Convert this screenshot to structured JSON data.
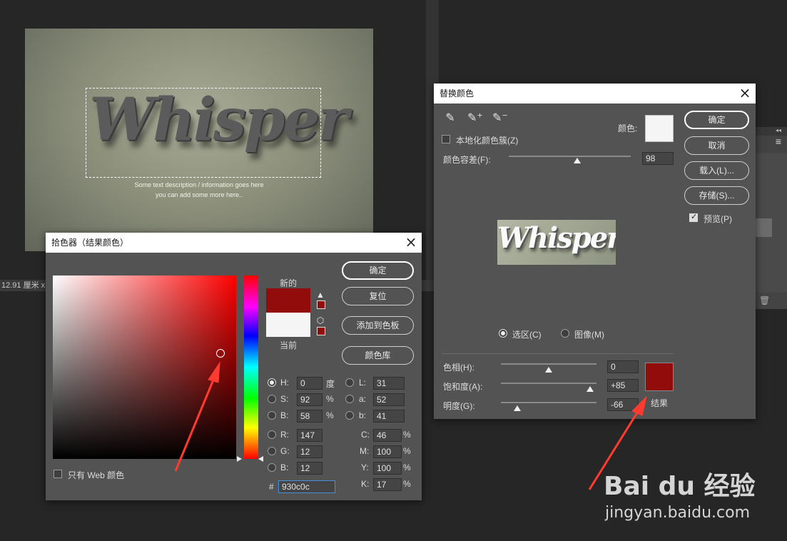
{
  "canvas": {
    "headline": "Whisper",
    "caption_line1": "Some text description / information goes here",
    "caption_line2": "you can add some more here.."
  },
  "status": {
    "dimensions": "12.91 厘米 x"
  },
  "picker": {
    "title": "拾色器（结果颜色）",
    "new_label": "新的",
    "current_label": "当前",
    "new_color": "#930c0c",
    "current_color": "#f5f5f5",
    "buttons": {
      "ok": "确定",
      "reset": "复位",
      "add_swatch": "添加到色板",
      "libraries": "颜色库"
    },
    "web_only_label": "只有 Web 颜色",
    "hsb": [
      {
        "label": "H:",
        "value": "0",
        "unit": "度"
      },
      {
        "label": "S:",
        "value": "92",
        "unit": "%"
      },
      {
        "label": "B:",
        "value": "58",
        "unit": "%"
      }
    ],
    "rgb": [
      {
        "label": "R:",
        "value": "147"
      },
      {
        "label": "G:",
        "value": "12"
      },
      {
        "label": "B:",
        "value": "12"
      }
    ],
    "lab": [
      {
        "label": "L:",
        "value": "31"
      },
      {
        "label": "a:",
        "value": "52"
      },
      {
        "label": "b:",
        "value": "41"
      }
    ],
    "cmyk": [
      {
        "label": "C:",
        "value": "46",
        "unit": "%"
      },
      {
        "label": "M:",
        "value": "100",
        "unit": "%"
      },
      {
        "label": "Y:",
        "value": "100",
        "unit": "%"
      },
      {
        "label": "K:",
        "value": "17",
        "unit": "%"
      }
    ],
    "hex_label": "#",
    "hex_value": "930c0c"
  },
  "replace": {
    "title": "替换颜色",
    "localized_label": "本地化颜色簇(Z)",
    "color_label": "颜色:",
    "swatch_color": "#f5f5f5",
    "tolerance_label": "颜色容差(F):",
    "tolerance_value": "98",
    "tolerance_fraction": 0.56,
    "buttons": {
      "ok": "确定",
      "cancel": "取消",
      "load": "载入(L)...",
      "save": "存储(S)..."
    },
    "preview_label": "预览(P)",
    "preview_text": "Whisper",
    "mode_selection": "选区(C)",
    "mode_image": "图像(M)",
    "hue_label": "色相(H):",
    "hue_value": "0",
    "hue_fraction": 0.5,
    "saturation_label": "饱和度(A):",
    "saturation_value": "+85",
    "saturation_fraction": 0.93,
    "lightness_label": "明度(G):",
    "lightness_value": "-66",
    "lightness_fraction": 0.17,
    "result_label": "结果",
    "result_color": "#930c0c"
  },
  "watermark": {
    "brand": "Bai du 经验",
    "url": "jingyan.baidu.com"
  }
}
